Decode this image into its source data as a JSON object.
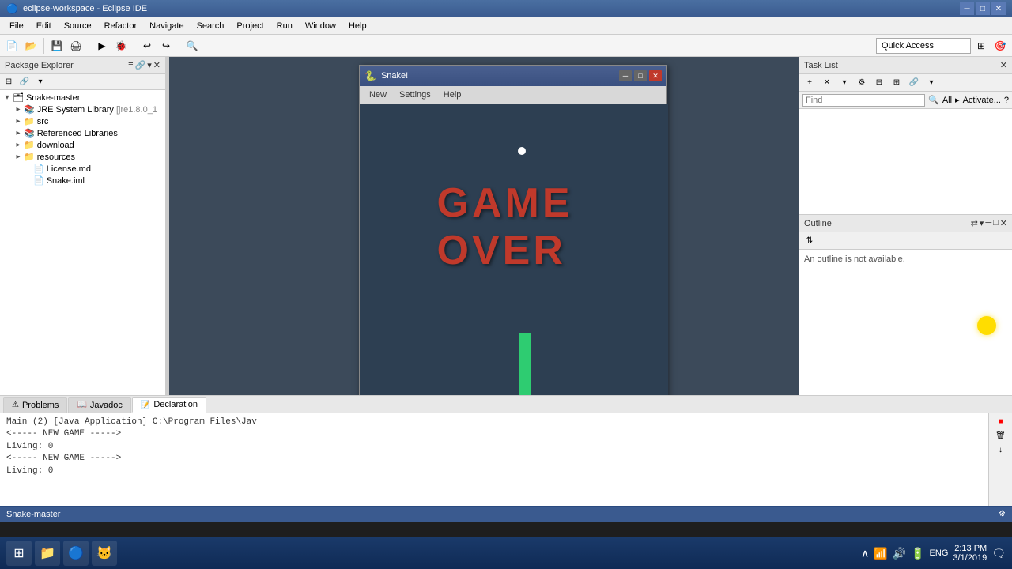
{
  "title_bar": {
    "icon": "🔵",
    "title": "eclipse-workspace - Eclipse IDE",
    "minimize": "─",
    "maximize": "□",
    "close": "✕"
  },
  "menu": {
    "items": [
      "File",
      "Edit",
      "Source",
      "Refactor",
      "Navigate",
      "Search",
      "Project",
      "Run",
      "Window",
      "Help"
    ]
  },
  "toolbar": {
    "quick_access_placeholder": "Quick Access"
  },
  "package_explorer": {
    "title": "Package Explorer",
    "root": "Snake-master",
    "items": [
      {
        "label": "JRE System Library [jre1.8.0_1",
        "icon": "📚",
        "indent": 2
      },
      {
        "label": "src",
        "icon": "📁",
        "indent": 2
      },
      {
        "label": "Referenced Libraries",
        "icon": "📚",
        "indent": 2
      },
      {
        "label": "download",
        "icon": "📁",
        "indent": 2
      },
      {
        "label": "resources",
        "icon": "📁",
        "indent": 2
      },
      {
        "label": "License.md",
        "icon": "📄",
        "indent": 2
      },
      {
        "label": "Snake.iml",
        "icon": "📄",
        "indent": 2
      }
    ]
  },
  "snake_window": {
    "title": "Snake!",
    "icon": "🐍",
    "menu": [
      "New",
      "Settings",
      "Help"
    ],
    "game_over_text": "GAME OVER"
  },
  "task_list": {
    "title": "Task List",
    "find_placeholder": "Find",
    "filter_all": "All",
    "activate": "Activate..."
  },
  "outline": {
    "title": "Outline",
    "message": "An outline is not available."
  },
  "bottom_tabs": [
    {
      "label": "Problems",
      "icon": "⚠"
    },
    {
      "label": "Javadoc",
      "icon": "📖"
    },
    {
      "label": "Declaration",
      "icon": "📝"
    }
  ],
  "console": {
    "header": "Main (2) [Java Application] C:\\Program Files\\Jav",
    "lines": [
      "<----- NEW GAME ----->",
      "Living: 0",
      "<----- NEW GAME ----->",
      "Living: 0"
    ]
  },
  "status_bar": {
    "project": "Snake-master"
  },
  "taskbar": {
    "programs": [
      {
        "icon": "⊞",
        "label": ""
      },
      {
        "icon": "📁",
        "label": ""
      },
      {
        "icon": "🔵",
        "label": ""
      },
      {
        "icon": "🐱",
        "label": ""
      }
    ],
    "sys_tray": {
      "time": "2:13 PM",
      "date": "3/1/2019",
      "lang": "ENG"
    }
  }
}
